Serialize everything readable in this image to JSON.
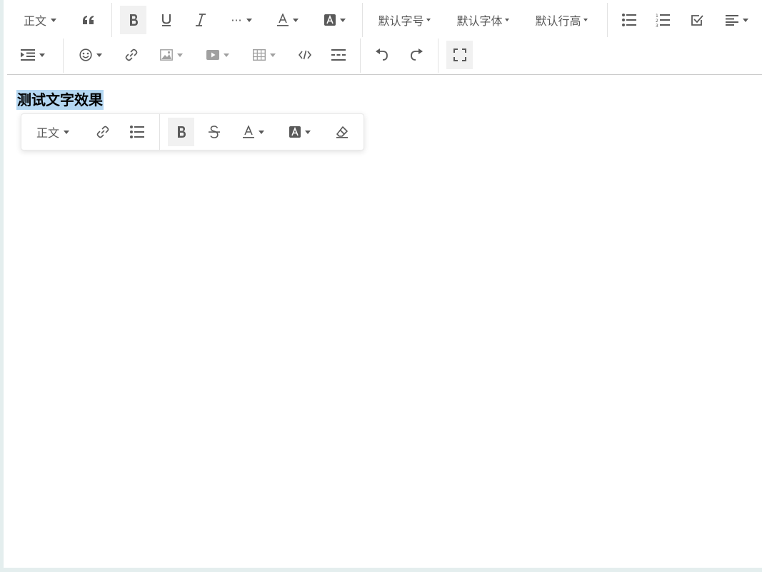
{
  "toolbar": {
    "heading_select": "正文",
    "quote_icon": "quote-icon",
    "bold_icon": "bold-icon",
    "underline_icon": "underline-icon",
    "italic_icon": "italic-icon",
    "more_label": "···",
    "font_color_icon": "font-color-icon",
    "bg_color_icon": "background-color-icon",
    "font_size_select": "默认字号",
    "font_family_select": "默认字体",
    "line_height_select": "默认行高",
    "bulleted_list_icon": "bulleted-list-icon",
    "numbered_list_icon": "numbered-list-icon",
    "todo_icon": "todo-icon",
    "align_icon": "align-left-icon",
    "indent_icon": "indent-icon",
    "emoji_icon": "emoji-icon",
    "link_icon": "link-icon",
    "image_icon": "image-icon",
    "video_icon": "video-icon",
    "table_icon": "table-icon",
    "code_icon": "code-icon",
    "divider_icon": "horizontal-rule-icon",
    "undo_icon": "undo-icon",
    "redo_icon": "redo-icon",
    "fullscreen_icon": "fullscreen-icon"
  },
  "editor": {
    "content_heading": "测试文字效果"
  },
  "hover_bar": {
    "heading_select": "正文",
    "link_icon": "link-icon",
    "bulleted_list_icon": "bulleted-list-icon",
    "bold_icon": "bold-icon",
    "strikethrough_icon": "strikethrough-icon",
    "font_color_icon": "font-color-icon",
    "bg_color_icon": "background-color-icon",
    "clear_format_icon": "eraser-icon"
  },
  "colors": {
    "selection": "#b4d7f2",
    "icon": "#595959",
    "active_bg": "#f1f1f1"
  }
}
